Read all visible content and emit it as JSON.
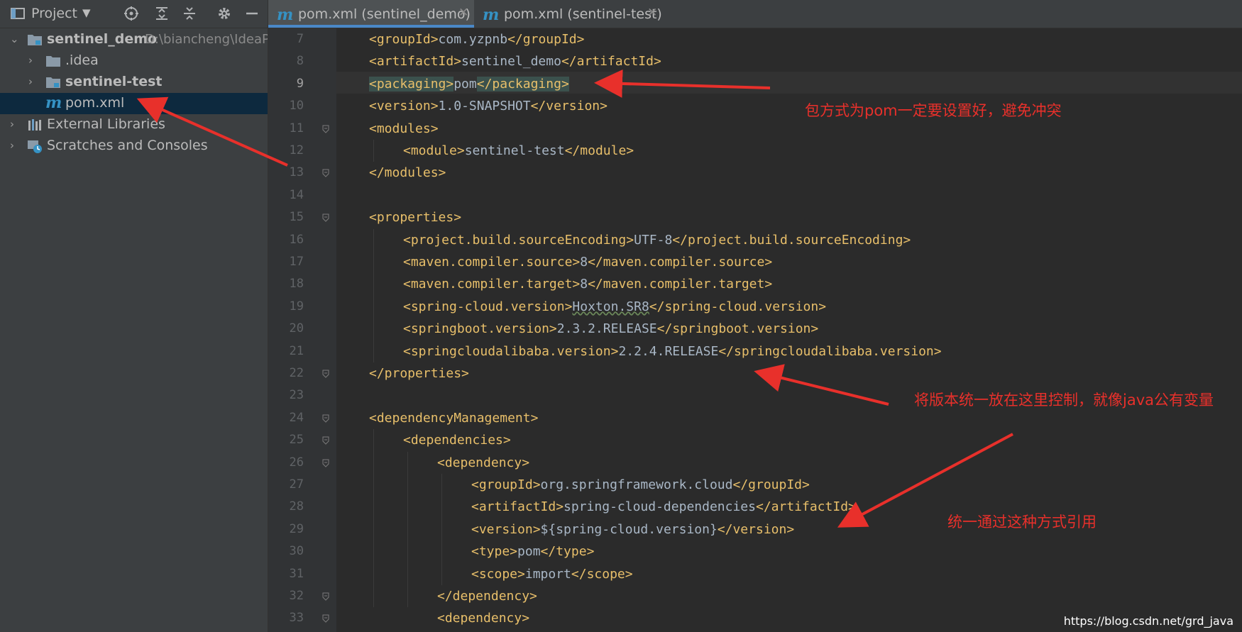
{
  "project_panel": {
    "title": "Project",
    "tree": [
      {
        "label": "sentinel_demo",
        "path": "D:\\biancheng\\IdeaP",
        "expanded": true,
        "icon": "module-folder-icon"
      },
      {
        "label": ".idea",
        "icon": "folder-icon"
      },
      {
        "label": "sentinel-test",
        "icon": "module-folder-icon"
      },
      {
        "label": "pom.xml",
        "icon": "maven-icon",
        "selected": true
      },
      {
        "label": "External Libraries",
        "icon": "libraries-icon"
      },
      {
        "label": "Scratches and Consoles",
        "icon": "scratches-icon"
      }
    ]
  },
  "tabs": [
    {
      "label": "pom.xml (sentinel_demo)",
      "active": true,
      "icon": "maven-icon"
    },
    {
      "label": "pom.xml (sentinel-test)",
      "active": false,
      "icon": "maven-icon"
    }
  ],
  "editor": {
    "current_line": 9,
    "line_numbers": [
      "7",
      "8",
      "9",
      "10",
      "11",
      "12",
      "13",
      "14",
      "15",
      "16",
      "17",
      "18",
      "19",
      "20",
      "21",
      "22",
      "23",
      "24",
      "25",
      "26",
      "27",
      "28",
      "29",
      "30",
      "31",
      "32",
      "33"
    ],
    "lines": [
      {
        "indent": 0,
        "open": "<groupId>",
        "text": "com.yzpnb",
        "close": "</groupId>"
      },
      {
        "indent": 0,
        "open": "<artifactId>",
        "text": "sentinel_demo",
        "close": "</artifactId>"
      },
      {
        "indent": 0,
        "open": "<packaging>",
        "text": "pom",
        "close": "</packaging>"
      },
      {
        "indent": 0,
        "open": "<version>",
        "text": "1.0-SNAPSHOT",
        "close": "</version>"
      },
      {
        "indent": 0,
        "open": "<modules>",
        "text": "",
        "close": ""
      },
      {
        "indent": 1,
        "open": "<module>",
        "text": "sentinel-test",
        "close": "</module>"
      },
      {
        "indent": 0,
        "open": "",
        "text": "",
        "close": "</modules>"
      },
      {
        "indent": 0,
        "open": "",
        "text": "",
        "close": ""
      },
      {
        "indent": 0,
        "open": "<properties>",
        "text": "",
        "close": ""
      },
      {
        "indent": 1,
        "open": "<project.build.sourceEncoding>",
        "text": "UTF-8",
        "close": "</project.build.sourceEncoding>"
      },
      {
        "indent": 1,
        "open": "<maven.compiler.source>",
        "text": "8",
        "close": "</maven.compiler.source>"
      },
      {
        "indent": 1,
        "open": "<maven.compiler.target>",
        "text": "8",
        "close": "</maven.compiler.target>"
      },
      {
        "indent": 1,
        "open": "<spring-cloud.version>",
        "text": "Hoxton.SR8",
        "close": "</spring-cloud.version>"
      },
      {
        "indent": 1,
        "open": "<springboot.version>",
        "text": "2.3.2.RELEASE",
        "close": "</springboot.version>"
      },
      {
        "indent": 1,
        "open": "<springcloudalibaba.version>",
        "text": "2.2.4.RELEASE",
        "close": "</springcloudalibaba.version>"
      },
      {
        "indent": 0,
        "open": "",
        "text": "",
        "close": "</properties>"
      },
      {
        "indent": 0,
        "open": "",
        "text": "",
        "close": ""
      },
      {
        "indent": 0,
        "open": "<dependencyManagement>",
        "text": "",
        "close": ""
      },
      {
        "indent": 1,
        "open": "<dependencies>",
        "text": "",
        "close": ""
      },
      {
        "indent": 2,
        "open": "<dependency>",
        "text": "",
        "close": ""
      },
      {
        "indent": 3,
        "open": "<groupId>",
        "text": "org.springframework.cloud",
        "close": "</groupId>"
      },
      {
        "indent": 3,
        "open": "<artifactId>",
        "text": "spring-cloud-dependencies",
        "close": "</artifactId>"
      },
      {
        "indent": 3,
        "open": "<version>",
        "text": "${spring-cloud.version}",
        "close": "</version>"
      },
      {
        "indent": 3,
        "open": "<type>",
        "text": "pom",
        "close": "</type>"
      },
      {
        "indent": 3,
        "open": "<scope>",
        "text": "import",
        "close": "</scope>"
      },
      {
        "indent": 2,
        "open": "",
        "text": "",
        "close": "</dependency>"
      },
      {
        "indent": 2,
        "open": "<dependency>",
        "text": "",
        "close": ""
      }
    ]
  },
  "annotations": {
    "note_packaging": "包方式为pom一定要设置好，避免冲突",
    "note_versions": "将版本统一放在这里控制，就像java公有变量",
    "note_reference": "统一通过这种方式引用",
    "color": "#e8302b"
  },
  "watermark": "https://blog.csdn.net/grd_java",
  "colors": {
    "editor_bg": "#2b2b2b",
    "gutter_bg": "#313335",
    "tag": "#e8bf6a",
    "text": "#a9b7c6",
    "accent": "#4a88c7",
    "selection": "#0d293e"
  }
}
